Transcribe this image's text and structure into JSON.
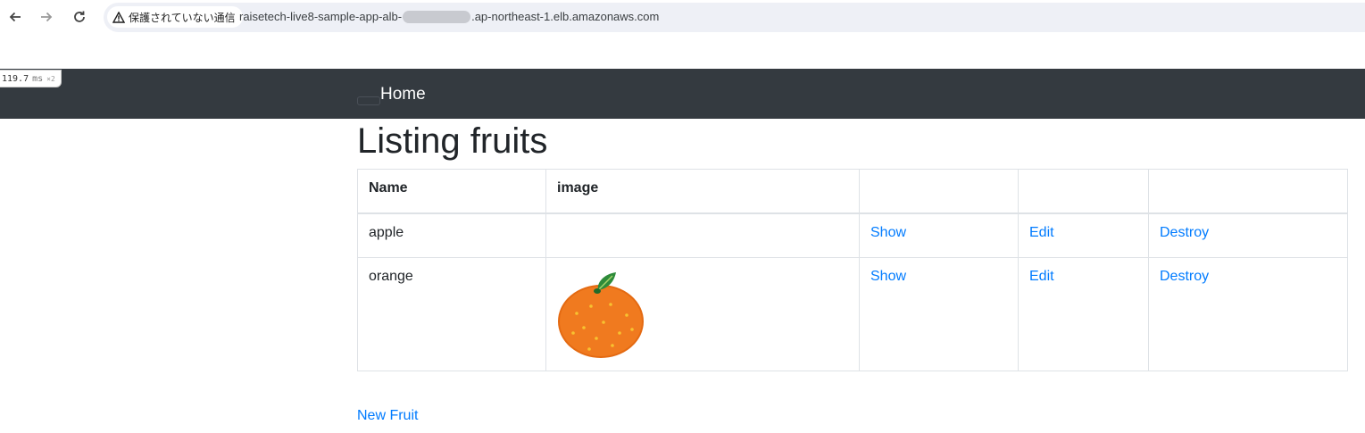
{
  "browser": {
    "security_label": "保護されていない通信",
    "url_prefix": "raisetech-live8-sample-app-alb-",
    "url_suffix": ".ap-northeast-1.elb.amazonaws.com",
    "icons": [
      "back-arrow-icon",
      "forward-arrow-icon",
      "reload-icon",
      "warning-icon"
    ]
  },
  "perf": {
    "value": "119.7",
    "unit": "ms",
    "multiplier": "×2"
  },
  "navbar": {
    "home_label": "Home"
  },
  "page": {
    "title": "Listing fruits"
  },
  "table": {
    "headers": [
      "Name",
      "image",
      "",
      "",
      ""
    ],
    "rows": [
      {
        "name": "apple",
        "has_image": false,
        "show": "Show",
        "edit": "Edit",
        "destroy": "Destroy"
      },
      {
        "name": "orange",
        "has_image": true,
        "image_alt": "orange-illustration",
        "show": "Show",
        "edit": "Edit",
        "destroy": "Destroy"
      }
    ]
  },
  "actions": {
    "new_label": "New Fruit"
  },
  "colors": {
    "navbar": "#343a40",
    "link": "#007bff",
    "orange": "#f07a1f",
    "leaf": "#2e8b3a"
  }
}
